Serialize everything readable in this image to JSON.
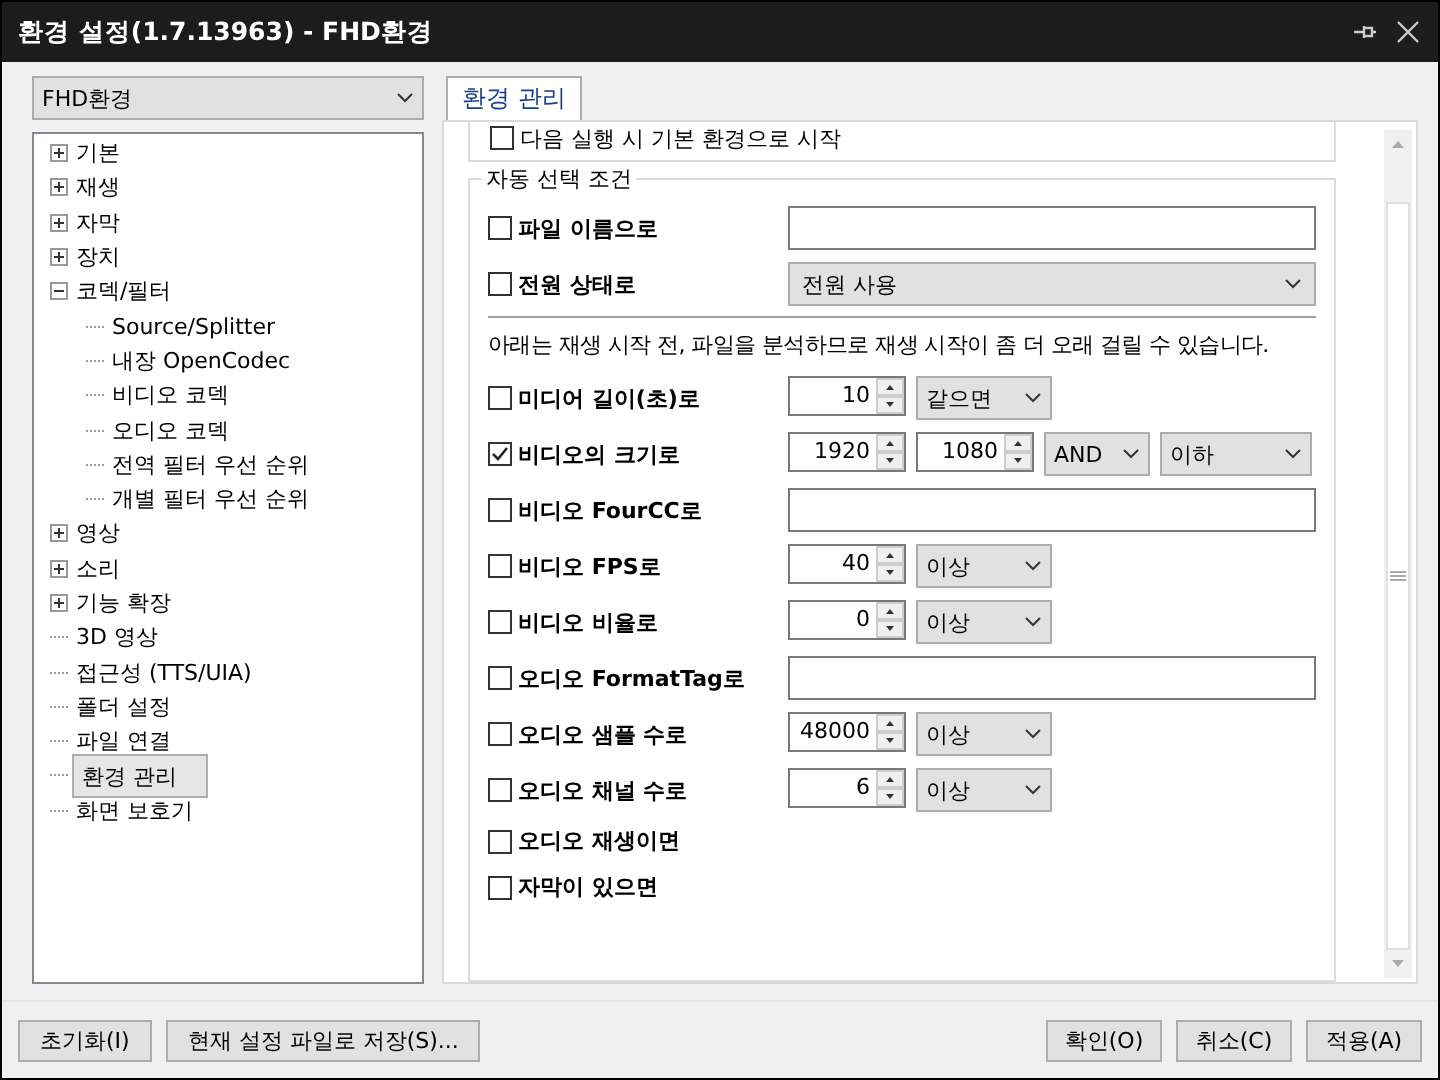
{
  "window": {
    "title": "환경 설정(1.7.13963) - FHD환경"
  },
  "profile_select": {
    "value": "FHD환경"
  },
  "tree": [
    {
      "label": "기본",
      "expanded": false,
      "selected": false
    },
    {
      "label": "재생",
      "expanded": false,
      "selected": false
    },
    {
      "label": "자막",
      "expanded": false,
      "selected": false
    },
    {
      "label": "장치",
      "expanded": false,
      "selected": false
    },
    {
      "label": "코덱/필터",
      "expanded": true,
      "selected": false,
      "children": [
        {
          "label": "Source/Splitter",
          "selected": false
        },
        {
          "label": "내장 OpenCodec",
          "selected": false
        },
        {
          "label": "비디오 코덱",
          "selected": false
        },
        {
          "label": "오디오 코덱",
          "selected": false
        },
        {
          "label": "전역 필터 우선 순위",
          "selected": false
        },
        {
          "label": "개별 필터 우선 순위",
          "selected": false
        }
      ]
    },
    {
      "label": "영상",
      "expanded": false,
      "selected": false
    },
    {
      "label": "소리",
      "expanded": false,
      "selected": false
    },
    {
      "label": "기능 확장",
      "expanded": false,
      "selected": false
    },
    {
      "label": "3D 영상",
      "selected": false
    },
    {
      "label": "접근성 (TTS/UIA)",
      "selected": false
    },
    {
      "label": "폴더 설정",
      "selected": false
    },
    {
      "label": "파일 연결",
      "selected": false
    },
    {
      "label": "환경 관리",
      "selected": true
    },
    {
      "label": "화면 보호기",
      "selected": false
    }
  ],
  "tabs": [
    {
      "label": "환경 관리",
      "selected": true
    }
  ],
  "top_option": {
    "label": "다음 실행 시 기본 환경으로 시작",
    "checked": false
  },
  "group": {
    "title": "자동 선택 조건",
    "rows_top": [
      {
        "label": "파일 이름으로",
        "checked": false,
        "controls": [
          {
            "kind": "text"
          }
        ]
      },
      {
        "label": "전원 상태로",
        "checked": false,
        "controls": [
          {
            "kind": "wideselect",
            "value": "전원 사용"
          }
        ]
      }
    ],
    "note": "아래는 재생 시작 전, 파일을 분석하므로 재생 시작이 좀 더 오래 걸릴 수 있습니다.",
    "rows": [
      {
        "label": "미디어 길이(초)로",
        "checked": false,
        "controls": [
          {
            "kind": "spin",
            "value": "10"
          },
          {
            "kind": "select",
            "value": "같으면"
          }
        ]
      },
      {
        "label": "비디오의 크기로",
        "checked": true,
        "controls": [
          {
            "kind": "spin",
            "value": "1920"
          },
          {
            "kind": "spin",
            "value": "1080"
          },
          {
            "kind": "smallselect",
            "value": "AND"
          },
          {
            "kind": "select",
            "value": "이하"
          }
        ]
      },
      {
        "label": "비디오 FourCC로",
        "checked": false,
        "controls": [
          {
            "kind": "text"
          }
        ]
      },
      {
        "label": "비디오 FPS로",
        "checked": false,
        "controls": [
          {
            "kind": "spin",
            "value": "40"
          },
          {
            "kind": "select",
            "value": "이상"
          }
        ]
      },
      {
        "label": "비디오 비율로",
        "checked": false,
        "controls": [
          {
            "kind": "spin",
            "value": "0"
          },
          {
            "kind": "select",
            "value": "이상"
          }
        ]
      },
      {
        "label": "오디오 FormatTag로",
        "checked": false,
        "controls": [
          {
            "kind": "text"
          }
        ]
      },
      {
        "label": "오디오 샘플 수로",
        "checked": false,
        "controls": [
          {
            "kind": "spin",
            "value": "48000"
          },
          {
            "kind": "select",
            "value": "이상"
          }
        ]
      },
      {
        "label": "오디오 채널 수로",
        "checked": false,
        "controls": [
          {
            "kind": "spin",
            "value": "6"
          },
          {
            "kind": "select",
            "value": "이상"
          }
        ]
      },
      {
        "label": "오디오 재생이면",
        "checked": false,
        "controls": []
      },
      {
        "label": "자막이 있으면",
        "checked": false,
        "controls": []
      }
    ]
  },
  "buttons_left": [
    "초기화(I)",
    "현재 설정 파일로 저장(S)..."
  ],
  "buttons_right": [
    "확인(O)",
    "취소(C)",
    "적용(A)"
  ]
}
